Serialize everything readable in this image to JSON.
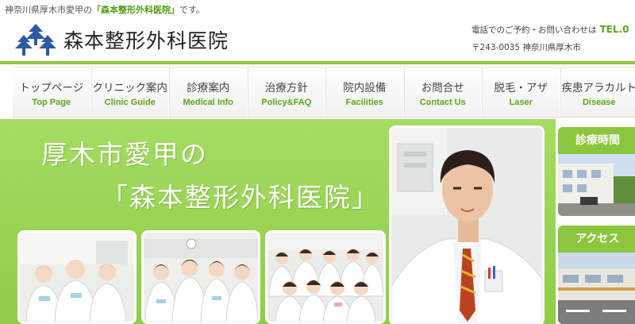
{
  "header": {
    "tagline_prefix": "神奈川県厚木市愛甲の",
    "tagline_clinic": "「森本整形外科医院」",
    "tagline_suffix": "です。",
    "clinic_name": "森本整形外科医院",
    "contact_text": "電話でのご予約・お問い合わせは",
    "tel_label": "TEL.0",
    "address": "〒243-0035 神奈川県厚木市"
  },
  "nav": [
    {
      "jp": "トップページ",
      "en": "Top Page"
    },
    {
      "jp": "クリニック案内",
      "en": "Clinic Guide"
    },
    {
      "jp": "診療案内",
      "en": "Medical Info"
    },
    {
      "jp": "治療方針",
      "en": "Policy&FAQ"
    },
    {
      "jp": "院内設備",
      "en": "Facilities"
    },
    {
      "jp": "お問合せ",
      "en": "Contact Us"
    },
    {
      "jp": "脱毛・アザ",
      "en": "Laser"
    },
    {
      "jp": "疾患アラカルト",
      "en": "Disease"
    }
  ],
  "hero": {
    "line1": "厚木市愛甲の",
    "line2": "「森本整形外科医院」"
  },
  "sidebar": {
    "hours_title": "診療時間",
    "access_title": "アクセス"
  },
  "colors": {
    "accent_green": "#8cc63e",
    "link_green": "#5aa61a",
    "logo_blue": "#2d5aa6"
  }
}
